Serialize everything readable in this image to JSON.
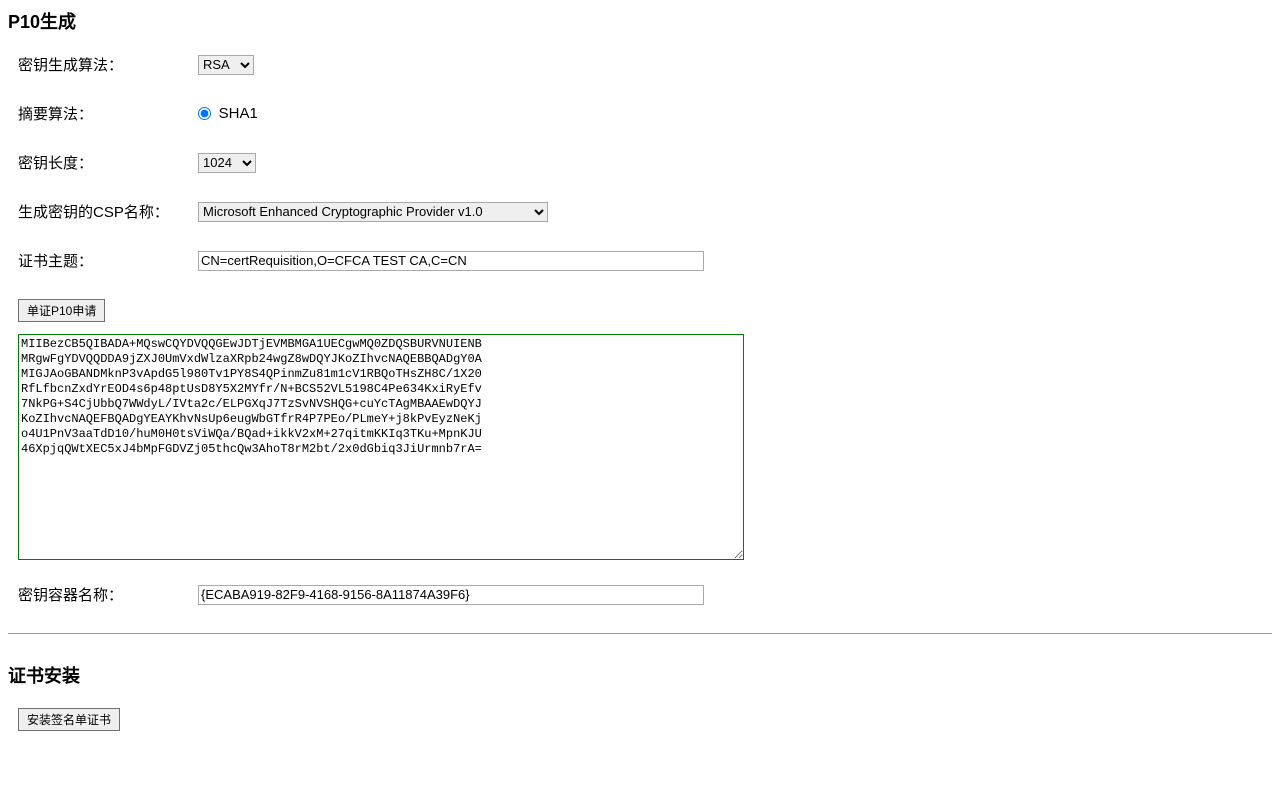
{
  "section1": {
    "title": "P10生成",
    "fields": {
      "algorithm": {
        "label": "密钥生成算法：",
        "value": "RSA"
      },
      "digest": {
        "label": "摘要算法：",
        "radio": "SHA1"
      },
      "keylen": {
        "label": "密钥长度：",
        "value": "1024"
      },
      "csp": {
        "label": "生成密钥的CSP名称：",
        "value": "Microsoft Enhanced Cryptographic Provider v1.0"
      },
      "subject": {
        "label": "证书主题：",
        "value": "CN=certRequisition,O=CFCA TEST CA,C=CN"
      },
      "container": {
        "label": "密钥容器名称：",
        "value": "{ECABA919-82F9-4168-9156-8A11874A39F6}"
      }
    },
    "apply_button": "单证P10申请",
    "p10_output": "MIIBezCB5QIBADA+MQswCQYDVQQGEwJDTjEVMBMGA1UECgwMQ0ZDQSBURVNUIENB\nMRgwFgYDVQQDDA9jZXJ0UmVxdWlzaXRpb24wgZ8wDQYJKoZIhvcNAQEBBQADgY0A\nMIGJAoGBANDMknP3vApdG5l980Tv1PY8S4QPinmZu81m1cV1RBQoTHsZH8C/1X20\nRfLfbcnZxdYrEOD4s6p48ptUsD8Y5X2MYfr/N+BCS52VL5198C4Pe634KxiRyEfv\n7NkPG+S4CjUbbQ7WWdyL/IVta2c/ELPGXqJ7TzSvNVSHQG+cuYcTAgMBAAEwDQYJ\nKoZIhvcNAQEFBQADgYEAYKhvNsUp6eugWbGTfrR4P7PEo/PLmeY+j8kPvEyzNeKj\no4U1PnV3aaTdD10/huM0H0tsViWQa/BQad+ikkV2xM+27qitmKKIq3TKu+MpnKJU\n46XpjqQWtXEC5xJ4bMpFGDVZj05thcQw3AhoT8rM2bt/2x0dGbiq3JiUrmnb7rA="
  },
  "section2": {
    "title": "证书安装",
    "install_button": "安装签名单证书"
  }
}
